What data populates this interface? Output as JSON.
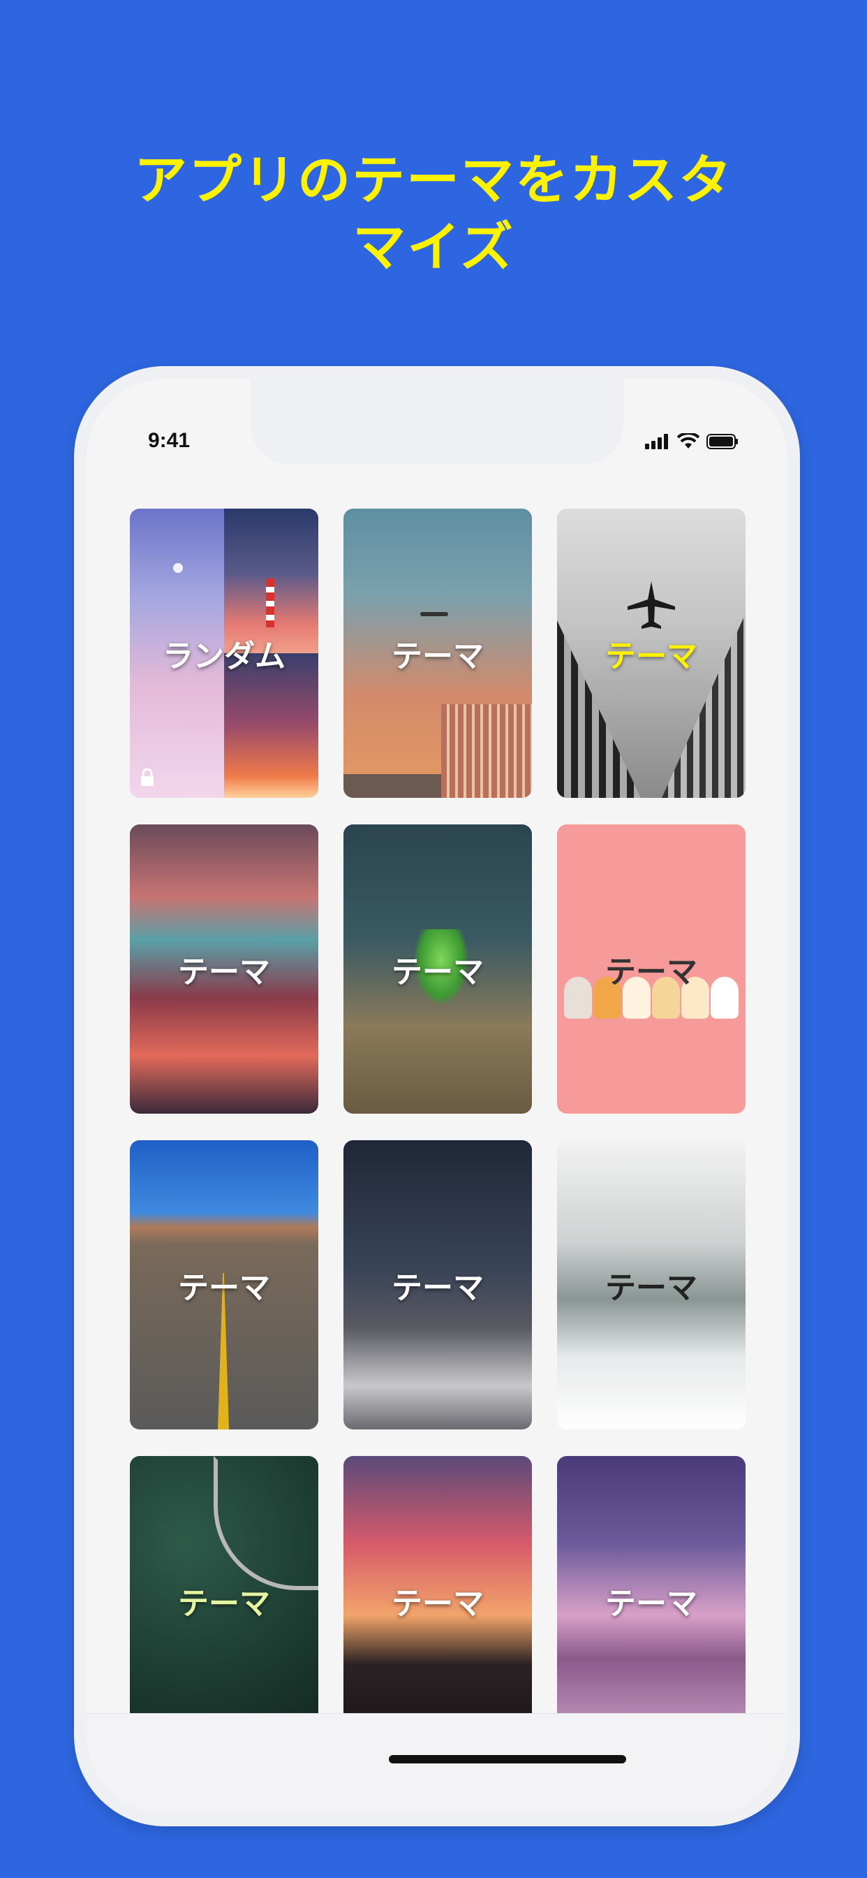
{
  "promo": {
    "headline_line1": "アプリのテーマをカスタ",
    "headline_line2": "マイズ"
  },
  "status_bar": {
    "time": "9:41",
    "icons": [
      "cellular-signal-icon",
      "wifi-icon",
      "battery-icon"
    ]
  },
  "themes": [
    {
      "label": "ランダム",
      "label_color": "#ffffff",
      "locked": true,
      "kind": "random"
    },
    {
      "label": "テーマ",
      "label_color": "#ffffff",
      "kind": "city-sky"
    },
    {
      "label": "テーマ",
      "label_color": "#fff200",
      "kind": "airplane-bw"
    },
    {
      "label": "テーマ",
      "label_color": "#ffffff",
      "kind": "sunset-clouds"
    },
    {
      "label": "テーマ",
      "label_color": "#ffffff",
      "kind": "sprout"
    },
    {
      "label": "テーマ",
      "label_color": "#333333",
      "kind": "cats-pink"
    },
    {
      "label": "テーマ",
      "label_color": "#ffffff",
      "kind": "road"
    },
    {
      "label": "テーマ",
      "label_color": "#ffffff",
      "kind": "starry-mountain"
    },
    {
      "label": "テーマ",
      "label_color": "#222222",
      "kind": "misty-lake"
    },
    {
      "label": "テーマ",
      "label_color": "#e8f5a0",
      "kind": "forest"
    },
    {
      "label": "テーマ",
      "label_color": "#ffffff",
      "kind": "sunset-tree"
    },
    {
      "label": "テーマ",
      "label_color": "#ffffff",
      "kind": "purple-lake"
    }
  ],
  "colors": {
    "background": "#2d66e0",
    "headline": "#fff200"
  }
}
